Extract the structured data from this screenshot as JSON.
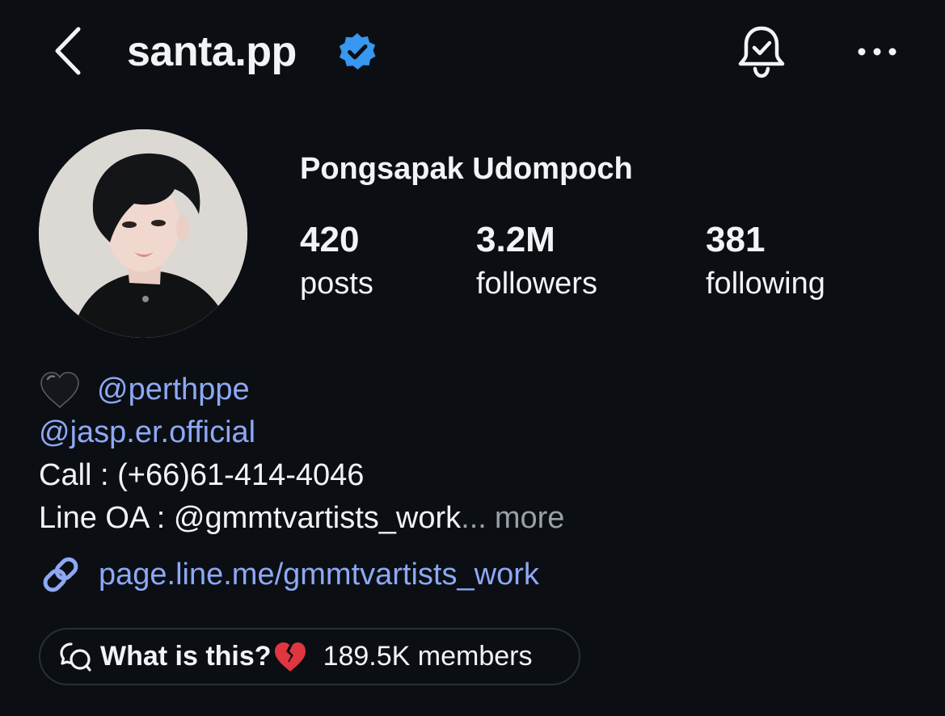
{
  "header": {
    "username": "santa.pp",
    "icons": {
      "back": "chevron-left-icon",
      "verified": "verified-badge-icon",
      "notifications": "bell-check-icon",
      "more": "more-horizontal-icon"
    }
  },
  "profile": {
    "full_name": "Pongsapak Udompoch",
    "stats": [
      {
        "count": "420",
        "label": "posts"
      },
      {
        "count": "3.2M",
        "label": "followers"
      },
      {
        "count": "381",
        "label": "following"
      }
    ]
  },
  "bio": {
    "mention_1": "@perthppe",
    "mention_2": "@jasp.er.official",
    "call": "Call : (+66)61-414-4046",
    "line_oa": "Line OA : @gmmtvartists_work",
    "ellipsis": "...",
    "more": "more"
  },
  "link": {
    "url": "page.line.me/gmmtvartists_work"
  },
  "channel": {
    "name": "What is this?",
    "members": "189.5K members"
  },
  "colors": {
    "background": "#0b0f14",
    "text": "#f2f3f5",
    "link": "#8ea8f4",
    "verified": "#3897f0",
    "muted": "#9aa0a6",
    "pill_border": "#2a2f36"
  }
}
